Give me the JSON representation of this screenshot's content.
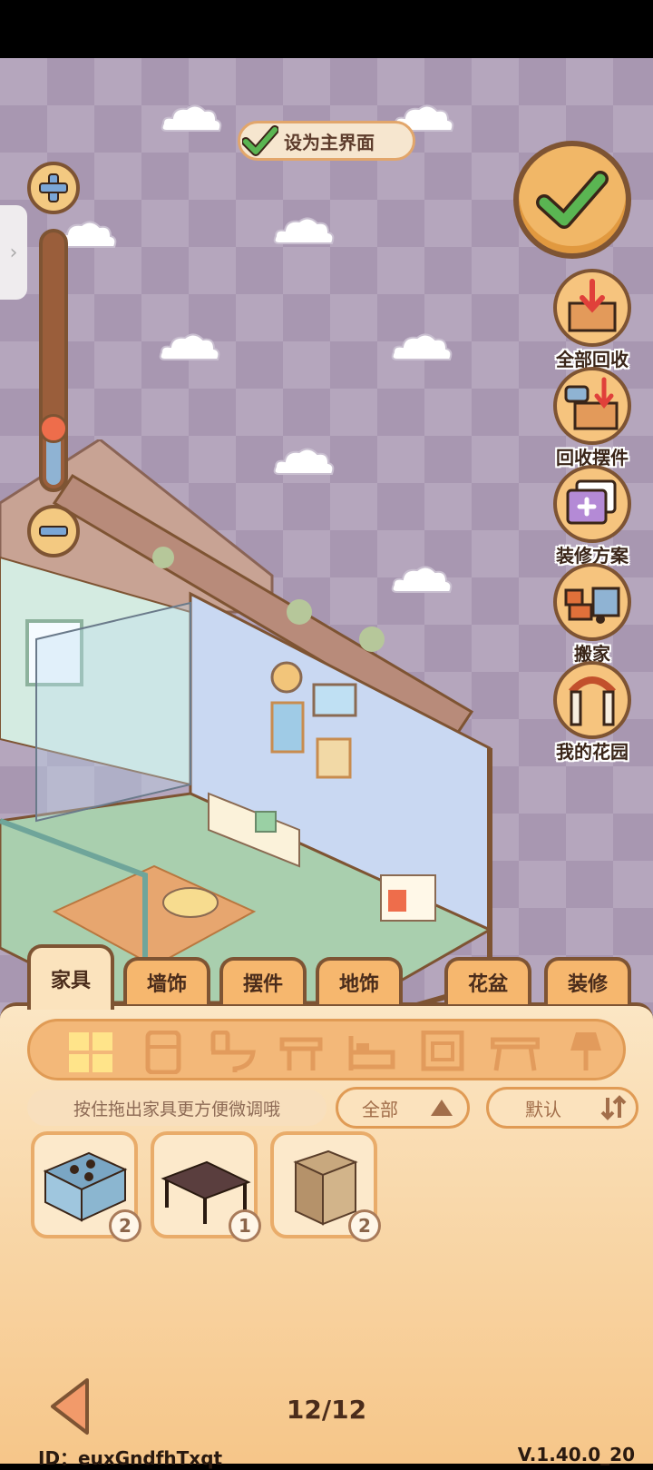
{
  "header": {
    "set_main_label": "设为主界面"
  },
  "right_menu": [
    {
      "label": "全部回收",
      "icon": "recycle-all-icon"
    },
    {
      "label": "回收摆件",
      "icon": "recycle-ornament-icon"
    },
    {
      "label": "装修方案",
      "icon": "decoration-plan-icon"
    },
    {
      "label": "搬家",
      "icon": "moving-truck-icon"
    },
    {
      "label": "我的花园",
      "icon": "garden-arch-icon"
    }
  ],
  "zoom": {
    "level": 0.28
  },
  "tabs": [
    {
      "label": "家具",
      "active": true
    },
    {
      "label": "墙饰",
      "active": false
    },
    {
      "label": "摆件",
      "active": false
    },
    {
      "label": "地饰",
      "active": false
    },
    {
      "label": "花盆",
      "active": false
    },
    {
      "label": "装修",
      "active": false
    }
  ],
  "categories": [
    "all-grid-icon",
    "fridge-icon",
    "toilet-icon",
    "stool-icon",
    "bed-icon",
    "cabinet-icon",
    "table-icon",
    "lamp-icon"
  ],
  "hint": "按住拖出家具更方便微调哦",
  "filters": {
    "scope": "全部",
    "sort": "默认"
  },
  "items": [
    {
      "name": "kitchen-counter",
      "count": "2"
    },
    {
      "name": "dark-table",
      "count": "1"
    },
    {
      "name": "cardboard-box",
      "count": "2"
    }
  ],
  "footer": {
    "page": "12/12",
    "id": "ID：euxGndfhTxqt",
    "version": "V.1.40.0_20"
  },
  "colors": {
    "frame_brown": "#7e5433",
    "panel_orange": "#f6c689",
    "accent_green": "#5ab552",
    "scene_lilac": "#b5a6bd"
  }
}
